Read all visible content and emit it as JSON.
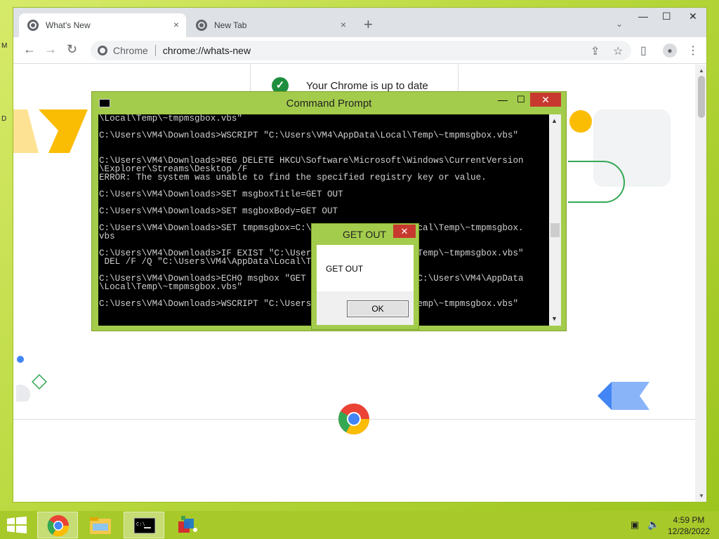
{
  "desktop": {
    "edge_label_top": "M",
    "edge_label_mid": "D"
  },
  "chrome": {
    "tabs": [
      {
        "title": "What's New",
        "close": "×",
        "active": true
      },
      {
        "title": "New Tab",
        "close": "×",
        "active": false
      }
    ],
    "new_tab": "+",
    "tab_search": "⌄",
    "window_controls": {
      "minimize": "—",
      "maximize": "☐",
      "close": "✕"
    },
    "nav": {
      "back": "←",
      "forward": "→",
      "reload": "↻"
    },
    "omnibox": {
      "site_label": "Chrome",
      "url": "chrome://whats-new"
    },
    "toolbar_icons": {
      "share": "⇪",
      "bookmark": "☆",
      "side_panel": "▯",
      "profile": "●",
      "menu": "⋮"
    },
    "page": {
      "update_status": "Your Chrome is up to date",
      "check": "✓"
    },
    "colors": {
      "accent_yellow": "#fbbc04",
      "accent_blue": "#4285f4",
      "accent_green": "#34a853",
      "accent_red": "#ea4335"
    }
  },
  "cmd": {
    "title": "Command Prompt",
    "controls": {
      "minimize": "—",
      "maximize": "☐",
      "close": "✕"
    },
    "lines": [
      "\\Local\\Temp\\~tmpmsgbox.vbs\"",
      "",
      "C:\\Users\\VM4\\Downloads>WSCRIPT \"C:\\Users\\VM4\\AppData\\Local\\Temp\\~tmpmsgbox.vbs\"",
      "",
      "",
      "C:\\Users\\VM4\\Downloads>REG DELETE HKCU\\Software\\Microsoft\\Windows\\CurrentVersion",
      "\\Explorer\\Streams\\Desktop /F",
      "ERROR: The system was unable to find the specified registry key or value.",
      "",
      "C:\\Users\\VM4\\Downloads>SET msgboxTitle=GET OUT",
      "",
      "C:\\Users\\VM4\\Downloads>SET msgboxBody=GET OUT",
      "",
      "C:\\Users\\VM4\\Downloads>SET tmpmsgbox=C:\\Users\\VM4\\AppData\\Local\\Temp\\~tmpmsgbox.",
      "vbs",
      "",
      "C:\\Users\\VM4\\Downloads>IF EXIST \"C:\\Users\\VM4\\AppData\\Local\\Temp\\~tmpmsgbox.vbs\"",
      " DEL /F /Q \"C:\\Users\\VM4\\AppData\\Local\\Temp\\~tmpmsgbox.vbs\"",
      "",
      "C:\\Users\\VM4\\Downloads>ECHO msgbox \"GET OUT\",0,\"GET OUT\" 1>\"C:\\Users\\VM4\\AppData",
      "\\Local\\Temp\\~tmpmsgbox.vbs\"",
      "",
      "C:\\Users\\VM4\\Downloads>WSCRIPT \"C:\\Users\\VM4\\AppData\\Local\\Temp\\~tmpmsgbox.vbs\""
    ],
    "scroll_up": "▲",
    "scroll_down": "▼"
  },
  "msgbox": {
    "title": "GET OUT",
    "close": "✕",
    "body": "GET OUT",
    "ok_label": "OK"
  },
  "taskbar": {
    "clock_time": "4:59 PM",
    "clock_date": "12/28/2022",
    "tray_network": "▣",
    "tray_volume": "🔈",
    "apps": [
      "chrome",
      "file-explorer",
      "command-prompt",
      "app"
    ]
  }
}
